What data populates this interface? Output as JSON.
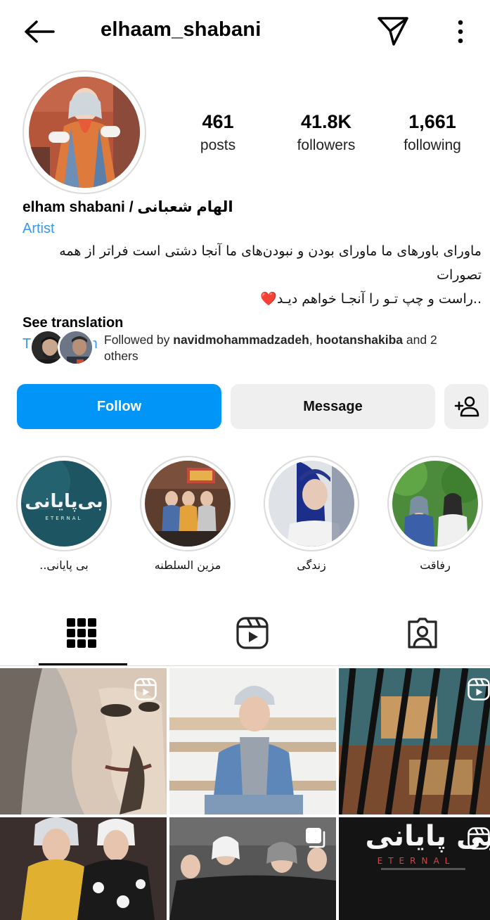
{
  "header": {
    "username": "elhaam_shabani",
    "back_icon": "arrow-left-icon",
    "send_icon": "paper-plane-icon",
    "more_icon": "kebab-menu-icon"
  },
  "stats": {
    "posts_count": "461",
    "posts_label": "posts",
    "followers_count": "41.8K",
    "followers_label": "followers",
    "following_count": "1,661",
    "following_label": "following"
  },
  "bio": {
    "name": "elham shabani / الهام شعبانی",
    "category": "Artist",
    "line1": "ماورای باورهای ما ماورای بودن و نبودن‌های ما آنجا دشتی است فراتر از همه تصورات",
    "line2": "..راست و چپ تـو را آنجـا خواهم دیـد",
    "heart": "❤️",
    "see_translation": "See translation",
    "location": "Tehran, Iran"
  },
  "followed_by": {
    "prefix": "Followed by ",
    "user1": "navidmohammadzadeh",
    "sep": ", ",
    "user2": "hootanshakiba",
    "suffix": " and 2 others"
  },
  "actions": {
    "follow_label": "Follow",
    "message_label": "Message",
    "add_user_icon": "add-person-icon"
  },
  "highlights": [
    {
      "label": "بی پایانی.."
    },
    {
      "label": "مزین السلطنه"
    },
    {
      "label": "زندگی"
    },
    {
      "label": "رفاقت"
    }
  ],
  "highlight_art": {
    "title": "بی‌پایانی",
    "sub": "ETERNAL"
  },
  "tabs": [
    "grid-icon",
    "reels-icon",
    "tagged-icon"
  ],
  "grid_art": {
    "poster_text": "بی پایانی",
    "poster_sub": "ETERNAL"
  },
  "colors": {
    "accent": "#0095f6",
    "link": "#3897f0",
    "heart": "#e0103a"
  }
}
